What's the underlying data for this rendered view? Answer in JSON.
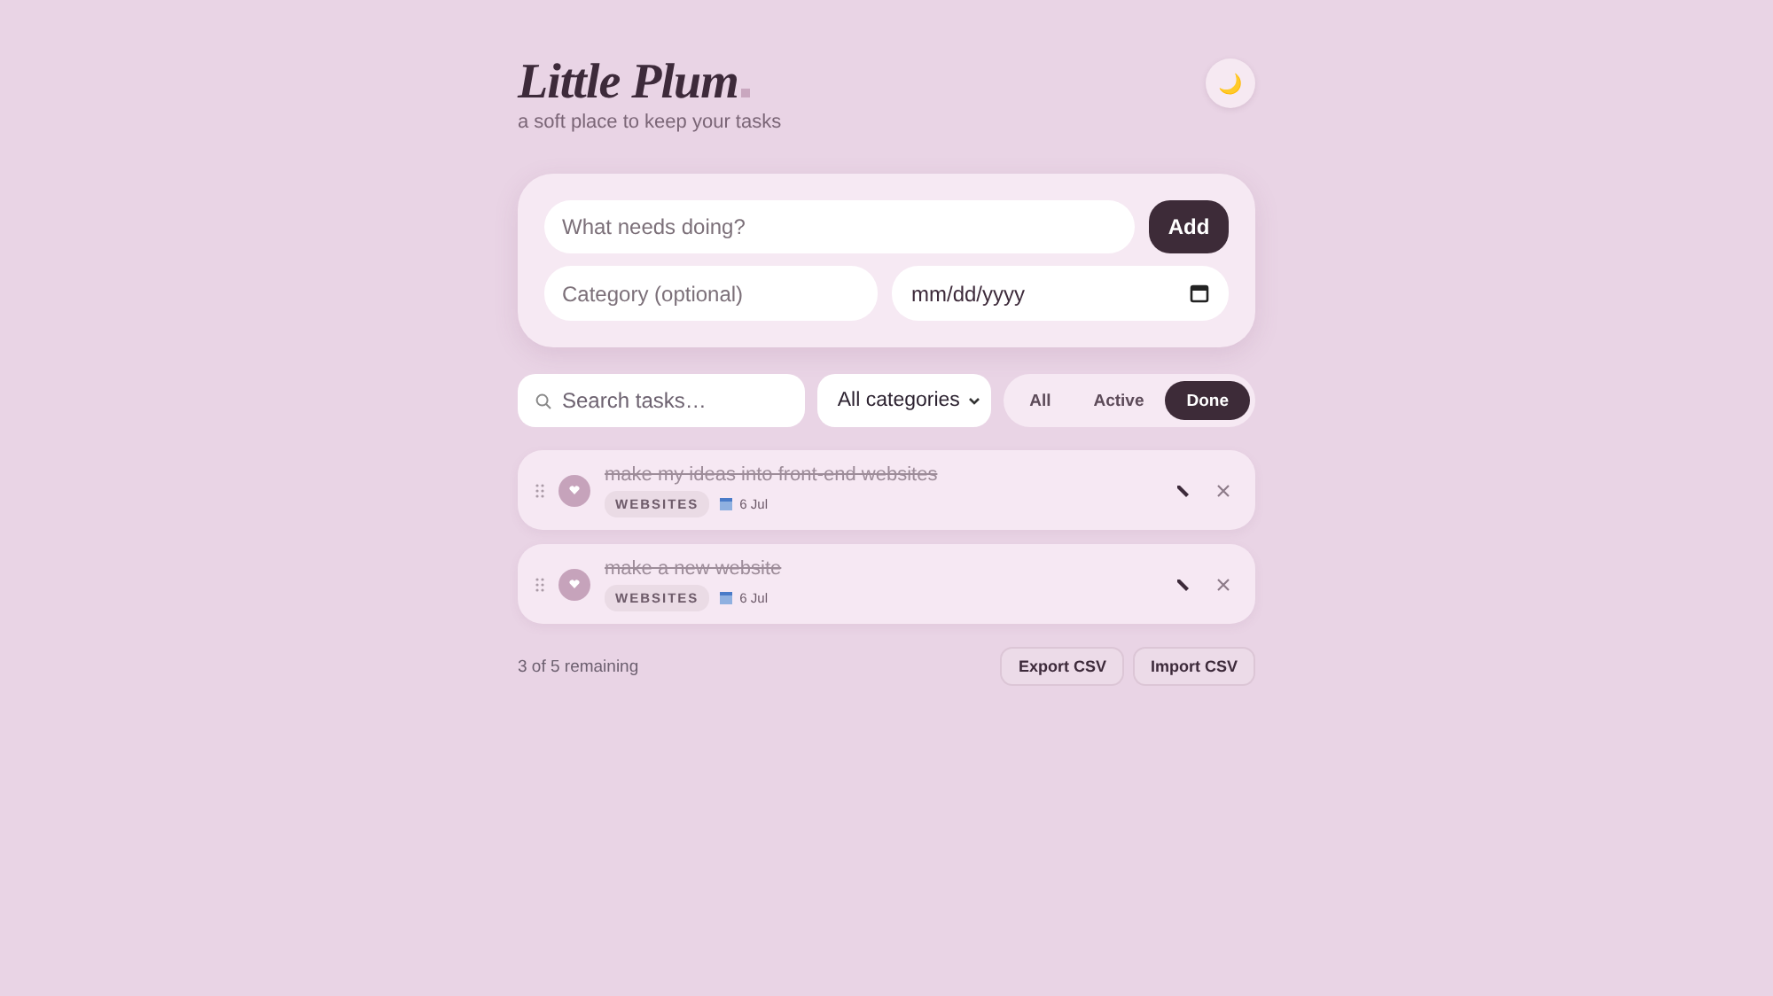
{
  "header": {
    "title": "Little Plum",
    "tagline": "a soft place to keep your tasks",
    "theme_toggle": "🌙"
  },
  "form": {
    "task": {
      "placeholder": "What needs doing?"
    },
    "add_button": "Add",
    "category": {
      "placeholder": "Category (optional)"
    },
    "date": {
      "value": "mm/dd/yyyy"
    }
  },
  "toolbar": {
    "search": {
      "placeholder": "Search tasks…"
    },
    "category_select": "All categories",
    "filters": [
      {
        "label": "All",
        "selected": false
      },
      {
        "label": "Active",
        "selected": false
      },
      {
        "label": "Done",
        "selected": true
      }
    ]
  },
  "tasks": [
    {
      "title": "make my ideas into front-end websites",
      "done": true,
      "category": "WEBSITES",
      "due": "6 Jul"
    },
    {
      "title": "make a new website",
      "done": true,
      "category": "WEBSITES",
      "due": "6 Jul"
    }
  ],
  "footer": {
    "remaining": "3 of 5 remaining",
    "buttons": [
      "Export CSV",
      "Import CSV"
    ]
  }
}
